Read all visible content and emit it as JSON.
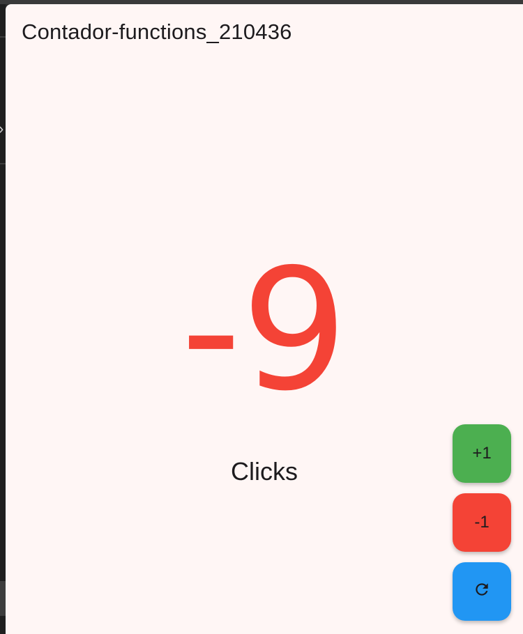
{
  "app": {
    "title": "Contador-functions_210436"
  },
  "counter": {
    "value": "-9",
    "label": "Clicks",
    "color": "#f44336"
  },
  "actions": {
    "increment_label": "+1",
    "increment_color": "#4caf50",
    "decrement_label": "-1",
    "decrement_color": "#f44336",
    "reset_icon": "refresh-icon",
    "reset_color": "#2196f3"
  }
}
